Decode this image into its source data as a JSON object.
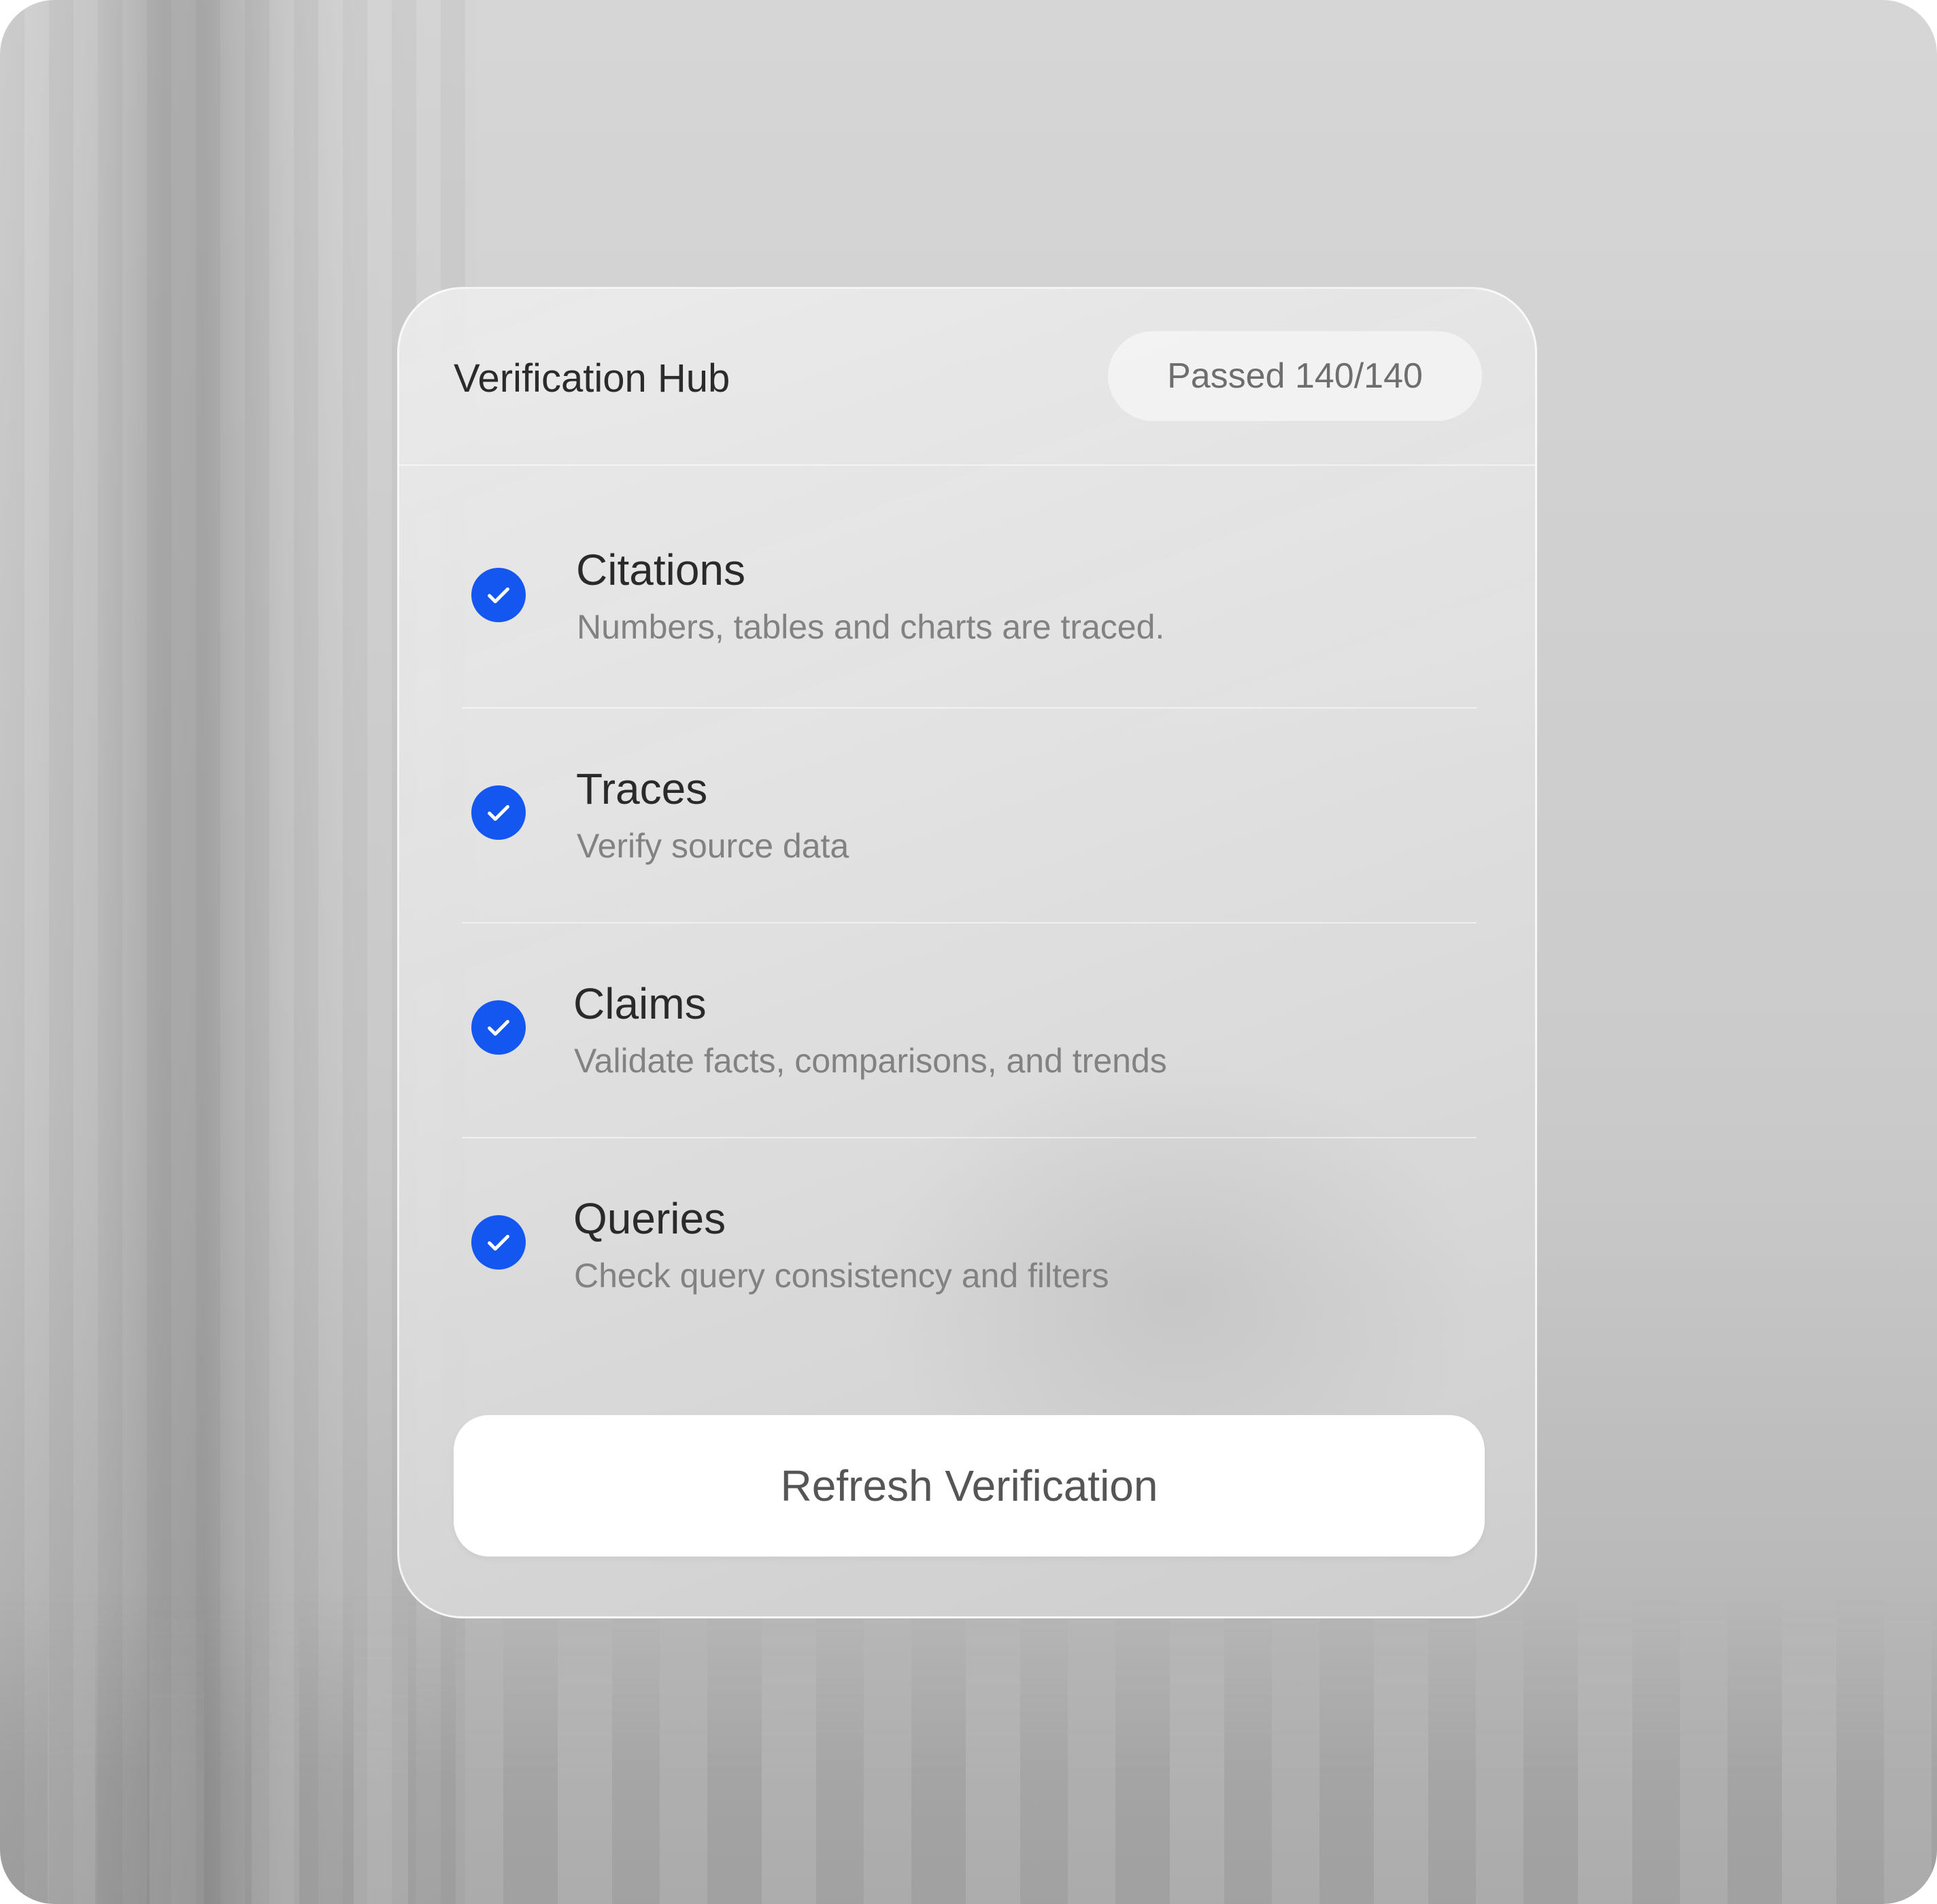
{
  "panel": {
    "title": "Verification Hub",
    "status_badge": "Passed 140/140"
  },
  "checks": [
    {
      "title": "Citations",
      "description": "Numbers, tables and charts are traced.",
      "status": "passed",
      "icon": "check-icon"
    },
    {
      "title": "Traces",
      "description": "Verify source data",
      "status": "passed",
      "icon": "check-icon"
    },
    {
      "title": "Claims",
      "description": "Validate facts, comparisons, and trends",
      "status": "passed",
      "icon": "check-icon"
    },
    {
      "title": "Queries",
      "description": "Check query consistency and filters",
      "status": "passed",
      "icon": "check-icon"
    }
  ],
  "actions": {
    "refresh_label": "Refresh Verification"
  },
  "colors": {
    "accent": "#1457f0",
    "button_bg": "#ffffff",
    "badge_bg": "#f5f5f5"
  }
}
